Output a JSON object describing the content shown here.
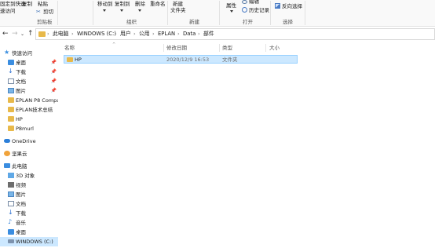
{
  "ribbon": {
    "pin_quick_access": "固定到快速",
    "quick_access_sub": "速访问",
    "copy": "复制",
    "paste": "粘贴",
    "cut": "剪切",
    "clipboard_group": "剪贴板",
    "move_to": "移动到",
    "copy_to": "复制到",
    "delete": "删除",
    "rename": "重命名",
    "organize_group": "组织",
    "new_folder_line1": "新建",
    "new_folder_line2": "文件夹",
    "new_group": "新建",
    "properties": "属性",
    "edit": "编辑",
    "history": "历史记录",
    "open_group": "打开",
    "invert_selection": "反向选择",
    "select_group": "选择"
  },
  "address": {
    "crumbs": [
      "此电脑",
      "WINDOWS (C:)",
      "用户",
      "公用",
      "EPLAN",
      "Data",
      "部件"
    ]
  },
  "columns": {
    "name": "名称",
    "date": "修改日期",
    "type": "类型",
    "size": "大小"
  },
  "files": [
    {
      "name": "HP",
      "date": "2020/12/9 16:53",
      "type": "文件夹",
      "size": ""
    }
  ],
  "nav": {
    "quick_access": "快速访问",
    "qa_items": [
      "桌面",
      "下载",
      "文档",
      "图片",
      "EPLAN P8 Compa",
      "EPLAN技术总结",
      "HP",
      "P8murl"
    ],
    "onedrive": "OneDrive",
    "jianguoyun": "坚果云",
    "this_pc": "此电脑",
    "pc_items": [
      "3D 对象",
      "视频",
      "图片",
      "文档",
      "下载",
      "音乐",
      "桌面",
      "WINDOWS (C:)"
    ]
  },
  "colors": {
    "selection": "#cce8ff",
    "folder": "#e8b94a",
    "accent": "#3a8de0"
  }
}
